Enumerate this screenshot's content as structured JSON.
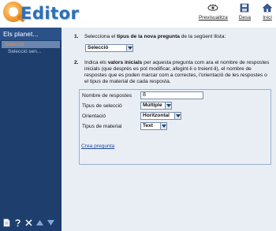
{
  "app": {
    "logo_text": "Editor"
  },
  "toolbar": {
    "preview_label": "Previsualitza",
    "save_label": "Desa",
    "home_label": "Inici"
  },
  "sidebar": {
    "title": "Els planet...",
    "items": [
      {
        "label": "Selecció",
        "selected": true
      },
      {
        "label": "Selecció sen...",
        "selected": false
      }
    ],
    "bottom_icons": [
      "new-page-icon",
      "help-question-icon",
      "delete-x-icon",
      "move-up-icon",
      "move-down-icon"
    ]
  },
  "main": {
    "step1": {
      "number": "1.",
      "text_before": "Selecciona el ",
      "text_bold": "tipus de la nova pregunta",
      "text_after": " de la següent llista:",
      "type_value": "Selecció"
    },
    "step2": {
      "number": "2.",
      "text_before": "Indica els ",
      "text_bold": "valors inicials",
      "text_after": " per aquesta pregunta com ara el nombre de respostes inicials (que després es pot modificar, afegint-li o treient-li), el nombre de respostes que es poden marcar com a correctes, l'orientació de les respostes o el tipus de material de cada resposta."
    },
    "form": {
      "num_answers_label": "Nombre de respostes",
      "num_answers_value": "8",
      "selection_type_label": "Tipus de selecció",
      "selection_type_value": "Múltiple",
      "orientation_label": "Orientació",
      "orientation_value": "Horitzontal",
      "material_type_label": "Tipus de material",
      "material_type_value": "Text"
    },
    "create_link": "Crea pregunta"
  },
  "colors": {
    "sidebar_bg": "#1e3f6e",
    "sidebar_title_bg": "#2b5189",
    "selected_item_bg": "#6b86b1",
    "selected_item_text": "#ff8a1a",
    "main_bg": "#e9eef5",
    "logo_blue": "#2f6fb3",
    "logo_orange": "#f29a2e"
  }
}
